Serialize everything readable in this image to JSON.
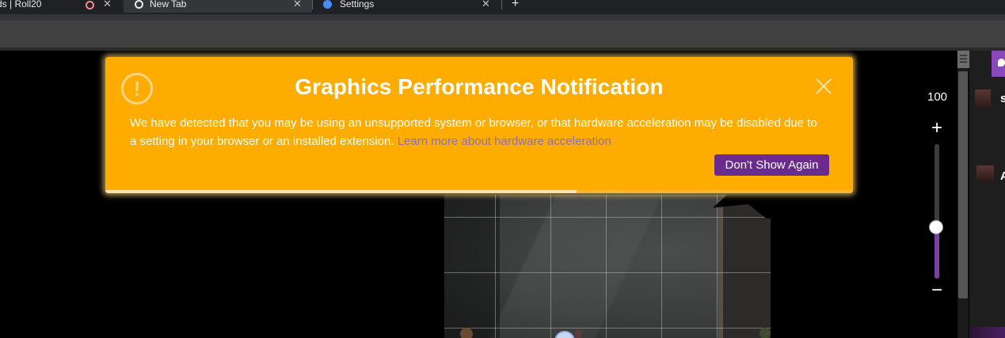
{
  "browser": {
    "tabs": [
      {
        "title": "ds | Roll20",
        "active": false
      },
      {
        "title": "New Tab",
        "active": true
      },
      {
        "title": "Settings",
        "active": false
      }
    ],
    "new_tab_label": "+"
  },
  "notification": {
    "title": "Graphics Performance Notification",
    "body": "We have detected that you may be using an unsupported system or browser, or that hardware acceleration may be disabled due to a setting in your browser or an installed extension.",
    "link_text": "Learn more about hardware acceleration",
    "button_label": "Don't Show Again",
    "warning_symbol": "!",
    "progress": 0.63,
    "colors": {
      "background": "#ffac00",
      "button": "#6b2a8e",
      "link": "#8e6fb1"
    }
  },
  "zoom": {
    "value_label": "100",
    "plus_label": "+",
    "minus_label": "−",
    "level": 0.38,
    "fill_color": "#7b3fa8"
  },
  "sidebar": {
    "entries": [
      {
        "initial": "s"
      },
      {
        "initial": "A"
      }
    ],
    "accent": "#8a49bb"
  },
  "icons": {
    "close": "close-icon",
    "warning": "warning-icon",
    "menu": "menu-icon",
    "chat": "chat-icon"
  }
}
